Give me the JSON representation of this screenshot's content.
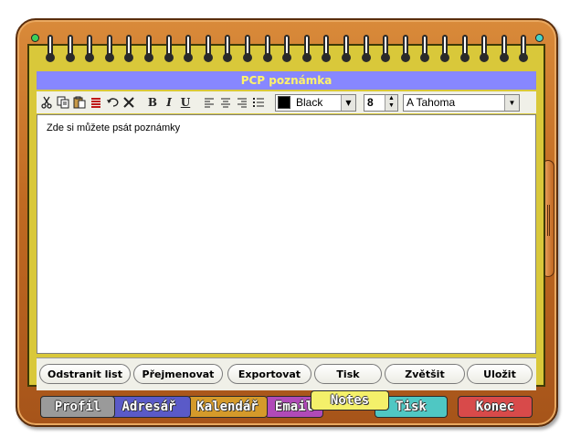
{
  "window": {
    "title": "PCP poznámka"
  },
  "toolbar": {
    "icons": [
      "cut-icon",
      "copy-icon",
      "paste-icon",
      "text-color-icon",
      "undo-icon",
      "clear-icon",
      "bold-icon",
      "italic-icon",
      "underline-icon",
      "align-left-icon",
      "align-center-icon",
      "align-right-icon",
      "bullets-icon"
    ],
    "bold_glyph": "B",
    "italic_glyph": "I",
    "underline_glyph": "U",
    "color_value": "Black",
    "size_value": "8",
    "font_value": "A Tahoma"
  },
  "editor": {
    "text": "Zde si můžete psát poznámky"
  },
  "buttons": {
    "remove": "Odstranit list",
    "rename": "Přejmenovat",
    "export": "Exportovat",
    "print": "Tisk",
    "zoom": "Zvětšit",
    "save": "Uložit"
  },
  "tabs": {
    "profil": "Profil",
    "adresar": "Adresář",
    "kalendar": "Kalendář",
    "email": "Email",
    "notes": "Notes",
    "tisk": "Tisk",
    "konec": "Konec"
  },
  "colors": {
    "title_bar": "#8787ff",
    "title_text": "#fff36a",
    "frame": "#c06a22",
    "page": "#d9c83a",
    "tab_profil": "#9a9a9a",
    "tab_adresar": "#5a5ac8",
    "tab_kalendar": "#d59a2a",
    "tab_email": "#b04ab8",
    "tab_notes": "#f4f06a",
    "tab_tisk": "#4fc7c3",
    "tab_konec": "#d84a4a"
  }
}
